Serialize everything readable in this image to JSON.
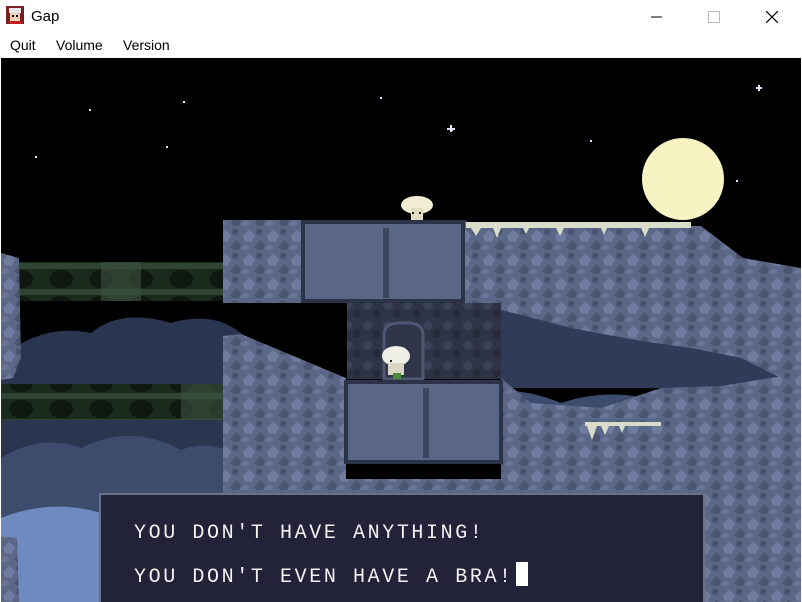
{
  "window": {
    "title": "Gap",
    "icon": "game-app-icon"
  },
  "controls": {
    "minimize": "minimize-icon",
    "maximize": "maximize-icon",
    "close": "close-icon"
  },
  "menu": {
    "items": [
      {
        "label": "Quit"
      },
      {
        "label": "Volume"
      },
      {
        "label": "Version"
      }
    ]
  },
  "scene": {
    "sky_color": "#000000",
    "moon_color": "#f7f3c2",
    "rock_color": "#5c6988",
    "cloud_color": "#3d4c6d"
  },
  "dialog": {
    "lines": [
      "YOU DON'T HAVE ANYTHING!",
      "YOU DON'T EVEN HAVE A BRA!"
    ],
    "cursor": "text-cursor-block"
  }
}
